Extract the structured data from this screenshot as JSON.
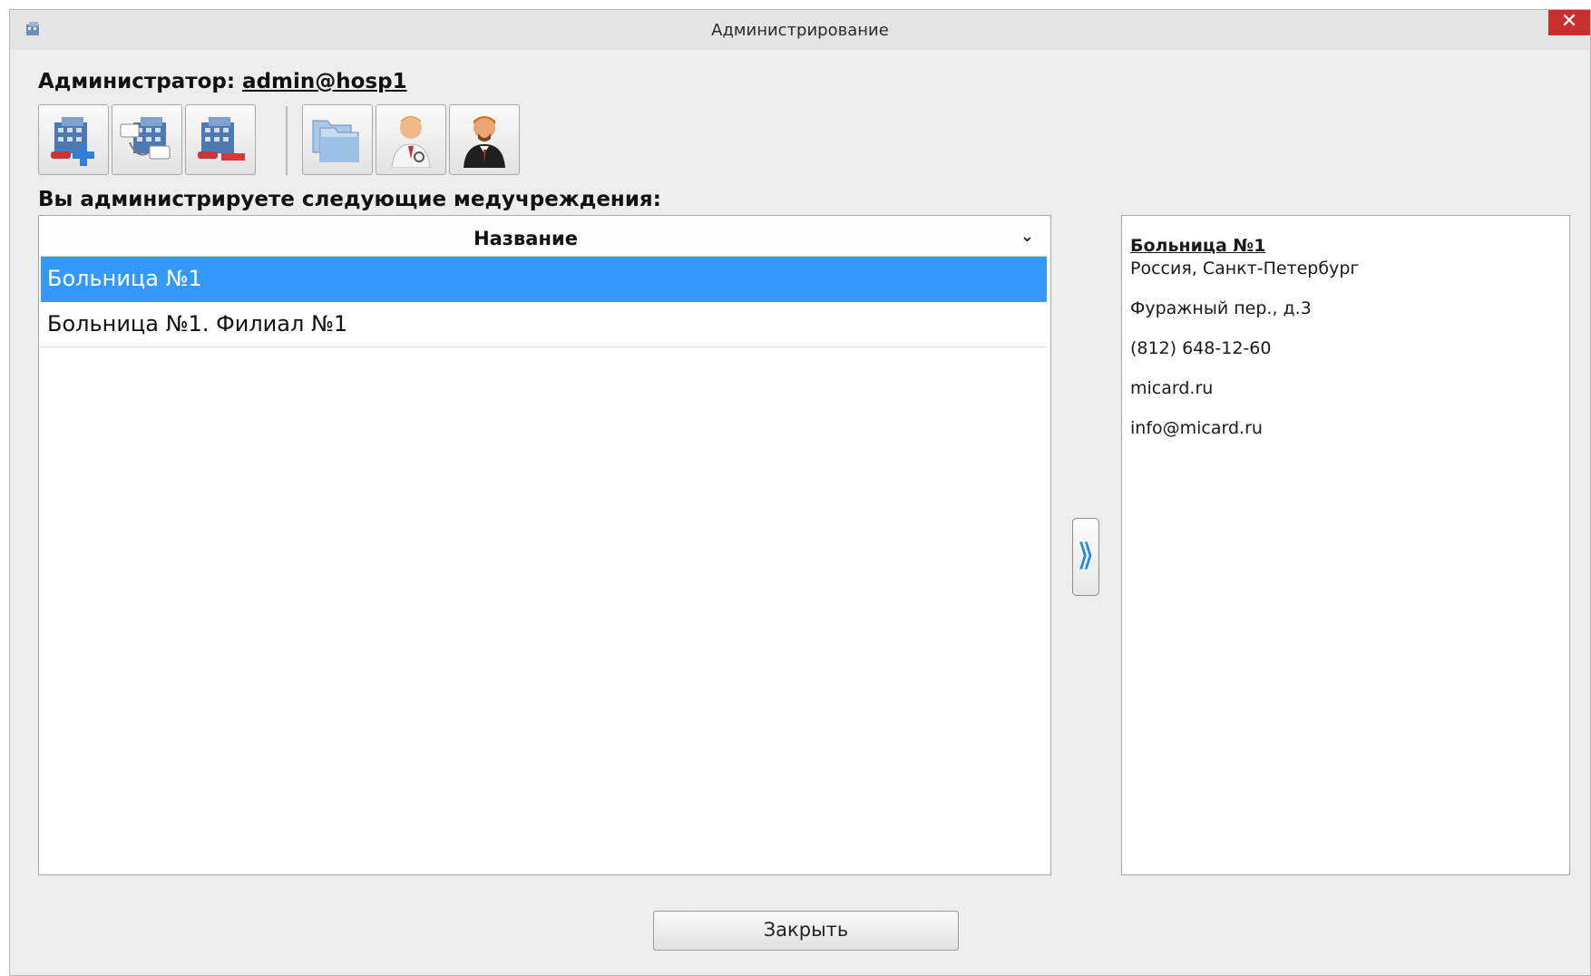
{
  "window": {
    "title": "Администрирование",
    "close_glyph": "✕"
  },
  "admin": {
    "label": "Администратор:",
    "login": "admin@hosp1"
  },
  "toolbar": {
    "buttons": [
      {
        "icon": "add-hospital-icon"
      },
      {
        "icon": "rename-hospital-icon"
      },
      {
        "icon": "remove-hospital-icon"
      },
      {
        "icon": "folders-icon"
      },
      {
        "icon": "doctor-icon"
      },
      {
        "icon": "manager-icon"
      }
    ]
  },
  "section_label": "Вы администрируете следующие медучреждения:",
  "list": {
    "column_header": "Название",
    "sort_glyph": "⌄",
    "rows": [
      "Больница №1",
      "Больница №1. Филиал №1"
    ],
    "selected_index": 0
  },
  "nav_arrow": "⟫",
  "details": {
    "name": "Больница №1",
    "location": "Россия, Санкт-Петербург",
    "address": "Фуражный пер., д.3",
    "phone": "(812) 648-12-60",
    "site": "micard.ru",
    "email": "info@micard.ru"
  },
  "footer": {
    "close_label": "Закрыть"
  },
  "colors": {
    "selection": "#3399ff",
    "close": "#c7312d",
    "accent_blue": "#1f8ae0"
  }
}
